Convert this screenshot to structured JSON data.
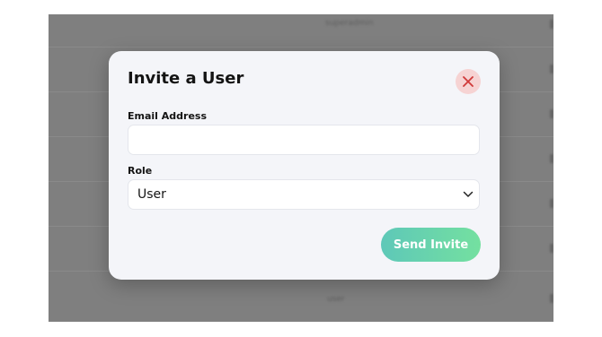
{
  "background_table": {
    "visible_cells": [
      "superadmin",
      "user"
    ]
  },
  "modal": {
    "title": "Invite a User",
    "close_icon": "close-icon",
    "email": {
      "label": "Email Address",
      "value": "",
      "placeholder": ""
    },
    "role": {
      "label": "Role",
      "selected": "User",
      "icon": "chevron-down-icon"
    },
    "submit_label": "Send Invite"
  },
  "colors": {
    "overlay": "#7f7f7f",
    "modal_background": "#f4f5f9",
    "close_button_bg": "#f6d3d3",
    "close_icon": "#d03a3a",
    "button_gradient_start": "#5ec8b8",
    "button_gradient_end": "#74e0a0"
  }
}
